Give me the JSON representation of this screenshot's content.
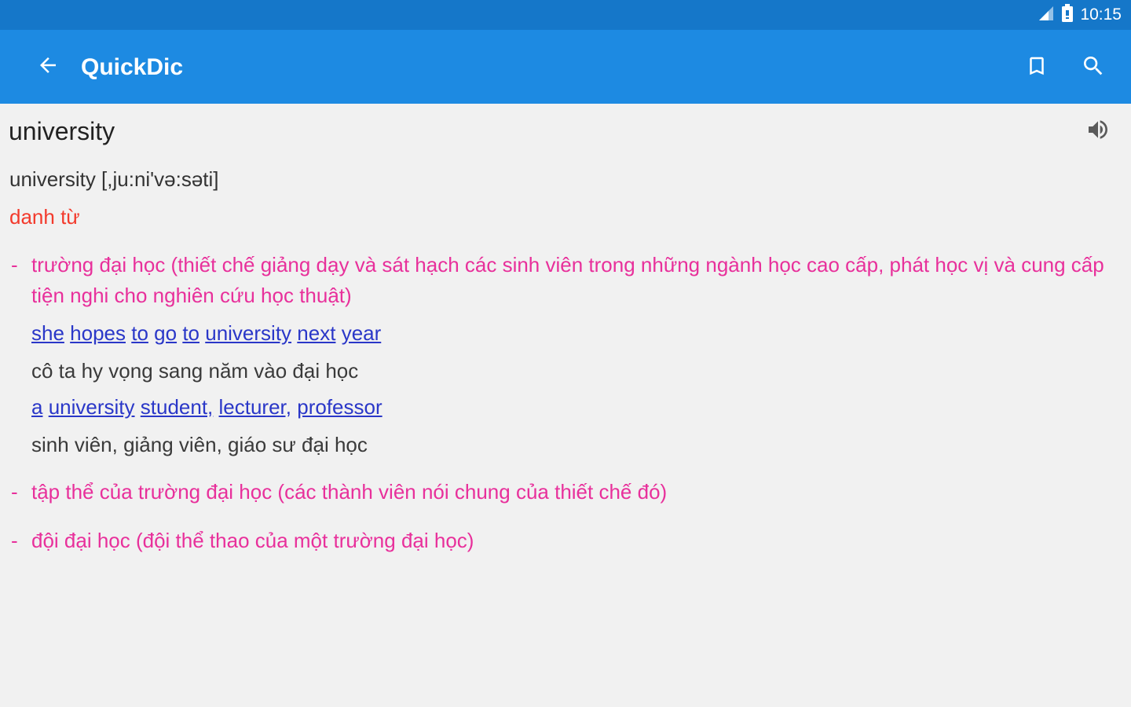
{
  "status_bar": {
    "time": "10:15",
    "icons": [
      "signal-icon",
      "battery-icon"
    ]
  },
  "app_bar": {
    "title": "QuickDic",
    "back_icon": "arrow-back-icon",
    "bookmark_icon": "bookmark-icon",
    "search_icon": "search-icon"
  },
  "entry": {
    "headword": "university",
    "speaker_icon": "volume-icon",
    "pronunciation": "university [,ju:ni'və:səti]",
    "part_of_speech": "danh từ",
    "senses": [
      {
        "dash": "-",
        "text": "trường đại học (thiết chế giảng dạy và sát hạch các sinh viên trong những ngành học cao cấp, phát học vị và cung cấp tiện nghi cho nghiên cứu học thuật)"
      },
      {
        "dash": "-",
        "text": "tập thể của trường đại học (các thành viên nói chung của thiết chế đó)"
      },
      {
        "dash": "-",
        "text": "đội đại học (đội thể thao của một trường đại học)"
      }
    ],
    "examples": [
      {
        "words": [
          "she",
          "hopes",
          "to",
          "go",
          "to",
          "university",
          "next",
          "year"
        ],
        "translation": "cô ta hy vọng sang năm vào đại học"
      },
      {
        "words": [
          "a",
          "university",
          "student,",
          "lecturer,",
          "professor"
        ],
        "translation": "sinh viên, giảng viên, giáo sư đại học"
      }
    ]
  },
  "colors": {
    "status_bar": "#1577c9",
    "app_bar": "#1d8ae2",
    "background": "#f1f1f1",
    "part_of_speech": "#f33a2c",
    "sense": "#e8309b",
    "link": "#2a37c8"
  }
}
